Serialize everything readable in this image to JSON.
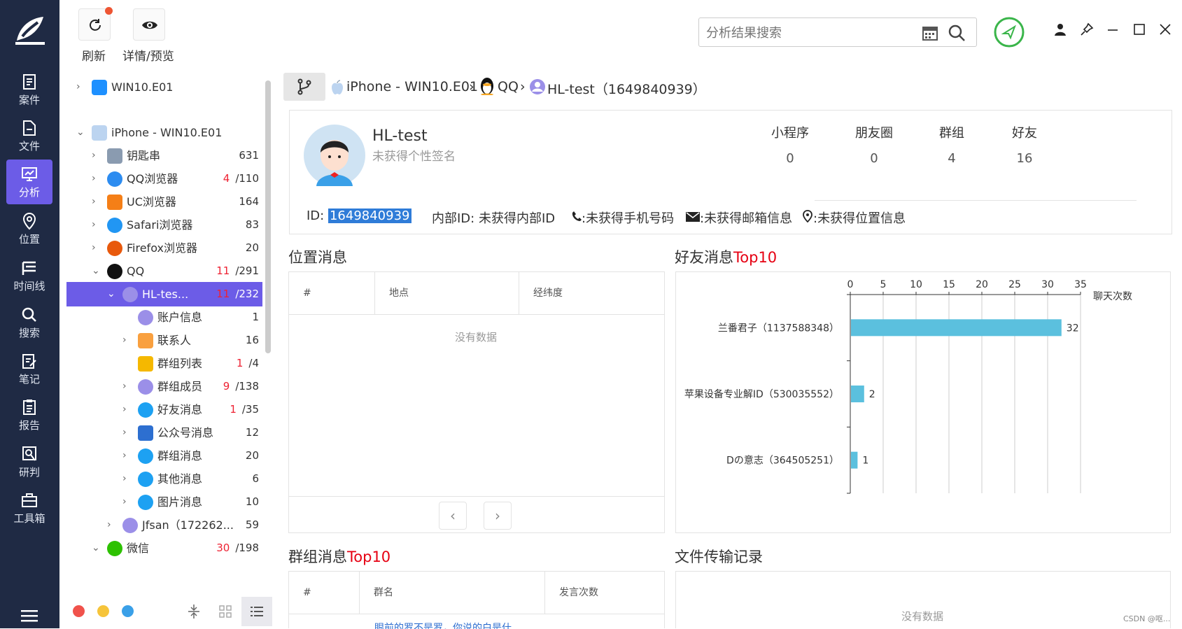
{
  "nav": {
    "items": [
      {
        "label": "案件",
        "icon": "case-icon"
      },
      {
        "label": "文件",
        "icon": "file-icon"
      },
      {
        "label": "分析",
        "icon": "analysis-icon"
      },
      {
        "label": "位置",
        "icon": "location-icon"
      },
      {
        "label": "时间线",
        "icon": "timeline-icon"
      },
      {
        "label": "搜索",
        "icon": "search-icon"
      },
      {
        "label": "笔记",
        "icon": "notes-icon"
      },
      {
        "label": "报告",
        "icon": "report-icon"
      },
      {
        "label": "研判",
        "icon": "research-icon"
      },
      {
        "label": "工具箱",
        "icon": "toolbox-icon"
      }
    ],
    "active": "分析"
  },
  "toolbar": {
    "refresh_label": "刷新",
    "preview_label": "详情/预览"
  },
  "search": {
    "placeholder": "分析结果搜索"
  },
  "tree": {
    "rows": [
      {
        "label": "WIN10.E01",
        "count": ""
      },
      {
        "label": "iPhone - WIN10.E01",
        "count": ""
      },
      {
        "label": "钥匙串",
        "count": "631"
      },
      {
        "label": "QQ浏览器",
        "count_red": "4",
        "count": "/110"
      },
      {
        "label": "UC浏览器",
        "count": "164"
      },
      {
        "label": "Safari浏览器",
        "count": "83"
      },
      {
        "label": "Firefox浏览器",
        "count": "20"
      },
      {
        "label": "QQ",
        "count_red": "11",
        "count": "/291"
      },
      {
        "label": "HL-tes...",
        "count_red": "11",
        "count": "/232"
      },
      {
        "label": "账户信息",
        "count": "1"
      },
      {
        "label": "联系人",
        "count": "16"
      },
      {
        "label": "群组列表",
        "count_red": "1",
        "count": "/4"
      },
      {
        "label": "群组成员",
        "count_red": "9",
        "count": "/138"
      },
      {
        "label": "好友消息",
        "count_red": "1",
        "count": "/35"
      },
      {
        "label": "公众号消息",
        "count": "12"
      },
      {
        "label": "群组消息",
        "count": "20"
      },
      {
        "label": "其他消息",
        "count": "6"
      },
      {
        "label": "图片消息",
        "count": "10"
      },
      {
        "label": "Jfsan（172262...",
        "count": "59"
      },
      {
        "label": "微信",
        "count_red": "30",
        "count": "/198"
      }
    ]
  },
  "breadcrumb": {
    "device": "iPhone - WIN10.E01",
    "app": "QQ",
    "account": "HL-test（1649840939）"
  },
  "profile": {
    "name": "HL-test",
    "signature": "未获得个性签名",
    "id_label": "ID:",
    "id_value": "1649840939",
    "internal_id": "内部ID: 未获得内部ID",
    "phone": ":未获得手机号码",
    "email": ":未获得邮箱信息",
    "location": ":未获得位置信息",
    "stats": [
      {
        "label": "小程序",
        "value": "0"
      },
      {
        "label": "朋友圈",
        "value": "0"
      },
      {
        "label": "群组",
        "value": "4"
      },
      {
        "label": "好友",
        "value": "16"
      }
    ]
  },
  "location_panel": {
    "title": "位置消息",
    "columns": [
      "#",
      "地点",
      "经纬度"
    ],
    "empty": "没有数据"
  },
  "friends_panel": {
    "title_main": "好友消息",
    "title_top": "Top10"
  },
  "group_panel": {
    "title_main": "群组消息",
    "title_top": "Top10",
    "columns": [
      "#",
      "群名",
      "发言次数"
    ],
    "first_row_partial": "眼前的罗不是罗，你说的白是什"
  },
  "file_panel": {
    "title": "文件传输记录",
    "empty": "没有数据"
  },
  "watermark": "CSDN @呕...",
  "chart_data": {
    "type": "bar",
    "orientation": "horizontal",
    "categories": [
      "兰番君子（1137588348）",
      "苹果设备专业解ID（530035552）",
      "Dの意志（364505251）"
    ],
    "values": [
      32,
      2,
      1
    ],
    "xlabel": "聊天次数",
    "xlim": [
      0,
      35
    ],
    "ticks": [
      "0",
      "5",
      "10",
      "15",
      "20",
      "25",
      "30",
      "35"
    ],
    "grid": true,
    "color": "#5bc0de"
  }
}
